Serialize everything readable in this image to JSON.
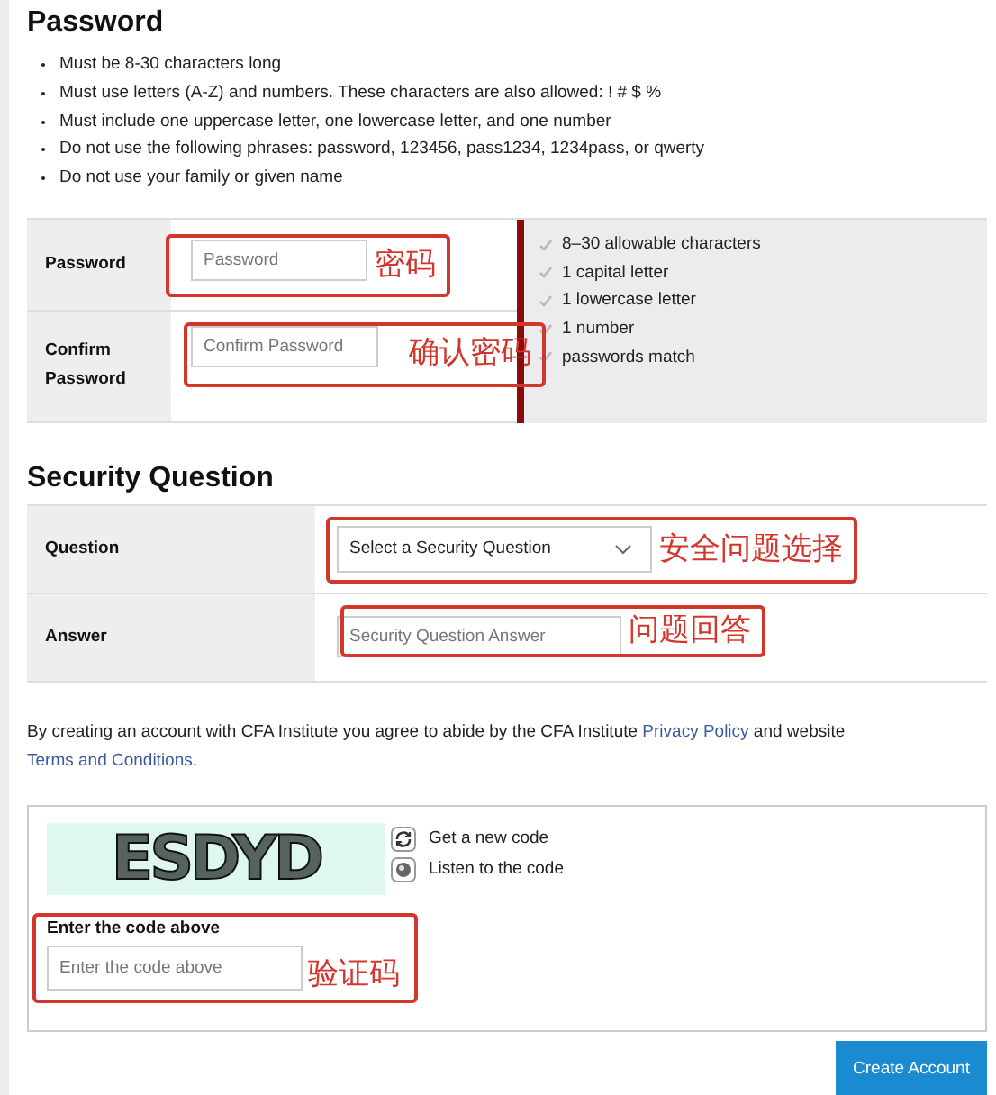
{
  "password_section": {
    "title": "Password",
    "rules": [
      "Must be 8-30 characters long",
      "Must use letters (A-Z) and numbers. These characters are also allowed: ! # $ %",
      "Must include one uppercase letter, one lowercase letter, and one number",
      "Do not use the following phrases: password, 123456, pass1234, 1234pass, or qwerty",
      "Do not use your family or given name"
    ],
    "fields": [
      {
        "label": "Password",
        "placeholder": "Password",
        "annotation": "密码"
      },
      {
        "label": "Confirm Password",
        "placeholder": "Confirm Password",
        "annotation": "确认密码"
      }
    ],
    "requirements": [
      {
        "text": "8–30 allowable characters",
        "checked": true
      },
      {
        "text": "1 capital letter",
        "checked": true
      },
      {
        "text": "1 lowercase letter",
        "checked": true
      },
      {
        "text": "1 number",
        "checked": true
      },
      {
        "text": "passwords match",
        "checked": true
      }
    ]
  },
  "security_section": {
    "title": "Security Question",
    "fields": [
      {
        "kind": "select",
        "label": "Question",
        "value": "Select a Security Question",
        "annotation": "安全问题选择"
      },
      {
        "kind": "input",
        "label": "Answer",
        "placeholder": "Security Question Answer",
        "annotation": "问题回答"
      }
    ]
  },
  "terms": [
    {
      "kind": "text",
      "text": "By creating an account with CFA Institute you agree to abide by the CFA Institute "
    },
    {
      "kind": "link",
      "text": "Privacy Policy"
    },
    {
      "kind": "text",
      "text": " and website "
    },
    {
      "kind": "link",
      "text": "Terms and Conditions"
    },
    {
      "kind": "text",
      "text": "."
    }
  ],
  "captcha": {
    "code": "ESDYD",
    "actions": [
      {
        "kind": "refresh",
        "label": "Get a new code"
      },
      {
        "kind": "audio",
        "label": "Listen to the code"
      }
    ],
    "label": "Enter the code above",
    "placeholder": "Enter the code above",
    "annotation": "验证码"
  },
  "submit_button": "Create Account"
}
